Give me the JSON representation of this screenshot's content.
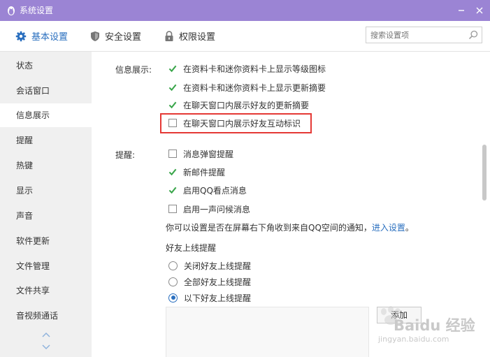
{
  "window": {
    "title": "系统设置"
  },
  "toolbar": {
    "tabs": [
      {
        "label": "基本设置"
      },
      {
        "label": "安全设置"
      },
      {
        "label": "权限设置"
      }
    ],
    "search_placeholder": "搜索设置项"
  },
  "sidebar": {
    "items": [
      {
        "label": "状态"
      },
      {
        "label": "会话窗口"
      },
      {
        "label": "信息展示"
      },
      {
        "label": "提醒"
      },
      {
        "label": "热键"
      },
      {
        "label": "显示"
      },
      {
        "label": "声音"
      },
      {
        "label": "软件更新"
      },
      {
        "label": "文件管理"
      },
      {
        "label": "文件共享"
      },
      {
        "label": "音视频通话"
      }
    ]
  },
  "info_display": {
    "label": "信息展示:",
    "options": [
      {
        "label": "在资料卡和迷你资料卡上显示等级图标",
        "checked": true
      },
      {
        "label": "在资料卡和迷你资料卡上显示更新摘要",
        "checked": true
      },
      {
        "label": "在聊天窗口内展示好友的更新摘要",
        "checked": true
      },
      {
        "label": "在聊天窗口内展示好友互动标识",
        "checked": false
      }
    ]
  },
  "reminders": {
    "label": "提醒:",
    "options": [
      {
        "label": "消息弹窗提醒",
        "checked": false
      },
      {
        "label": "新邮件提醒",
        "checked": true
      },
      {
        "label": "启用QQ看点消息",
        "checked": true
      },
      {
        "label": "启用一声问候消息",
        "checked": false
      }
    ],
    "notice_text": "你可以设置是否在屏幕右下角收到来自QQ空间的通知，",
    "notice_link": "进入设置",
    "notice_end": "。"
  },
  "friend_online": {
    "title": "好友上线提醒",
    "options": [
      {
        "label": "关闭好友上线提醒",
        "selected": false
      },
      {
        "label": "全部好友上线提醒",
        "selected": false
      },
      {
        "label": "以下好友上线提醒",
        "selected": true
      }
    ],
    "add_button": "添加"
  },
  "watermark": {
    "text": "Baidu 经验",
    "sub": "jingyan.baidu.com"
  },
  "colors": {
    "titlebar": "#9b84d4",
    "accent": "#2a6fbf",
    "check": "#3aa64b",
    "highlight": "#e53935"
  }
}
